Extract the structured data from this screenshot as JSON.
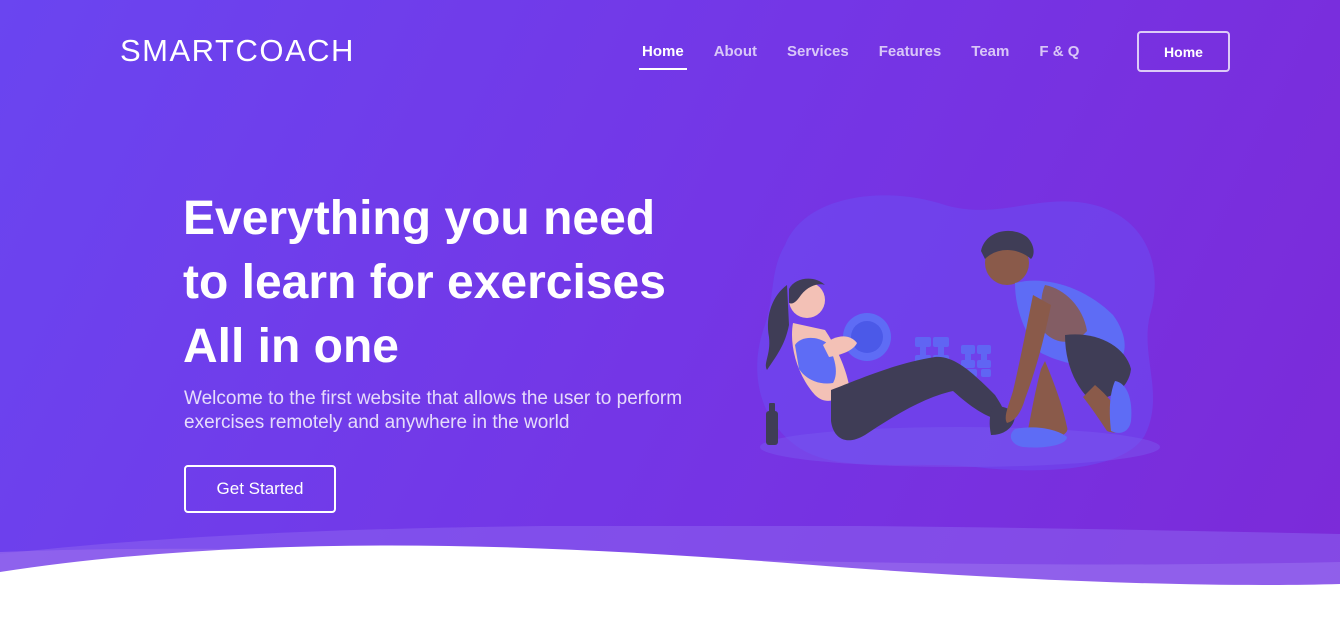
{
  "header": {
    "logo": "SMARTCOACH",
    "nav": [
      {
        "label": "Home",
        "active": true
      },
      {
        "label": "About",
        "active": false
      },
      {
        "label": "Services",
        "active": false
      },
      {
        "label": "Features",
        "active": false
      },
      {
        "label": "Team",
        "active": false
      },
      {
        "label": "F & Q",
        "active": false
      }
    ],
    "button_label": "Home"
  },
  "hero": {
    "headline_lines": [
      "Everything you need",
      "to learn for exercises",
      "All in one"
    ],
    "subtitle": "Welcome to the first website that allows the user to perform exercises remotely and anywhere in the world",
    "cta_label": "Get Started",
    "illustration_icon": "fitness-trainer-illustration"
  },
  "colors": {
    "gradient_start": "#6a45f0",
    "gradient_end": "#7c2ad8",
    "accent_blue": "#5e6cf5",
    "dark_figure": "#3f3d56",
    "skin_light": "#f3c1b6",
    "skin_dark": "#8a5a4a"
  }
}
